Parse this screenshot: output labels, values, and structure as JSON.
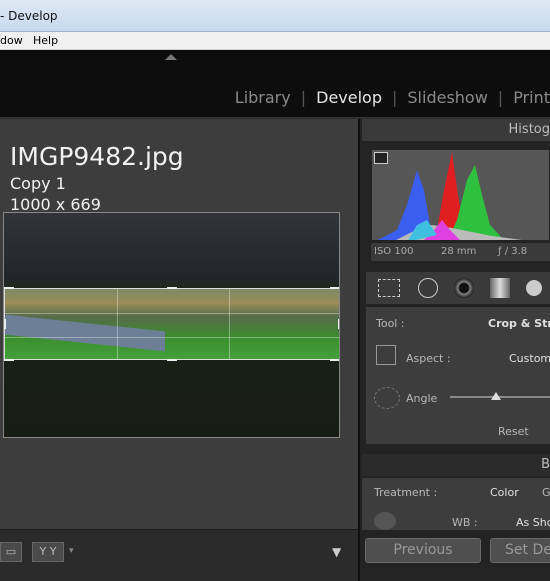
{
  "window": {
    "title": "- Develop"
  },
  "menu": {
    "window_label": "dow",
    "help_label": "Help"
  },
  "modules": {
    "library": "Library",
    "develop": "Develop",
    "slideshow": "Slideshow",
    "print": "Print"
  },
  "image": {
    "filename": "IMGP9482.jpg",
    "copy": "Copy 1",
    "dimensions": "1000 x 669"
  },
  "panel": {
    "histogram_label": "Histog",
    "iso": "ISO 100",
    "focal": "28 mm",
    "aperture": "ƒ / 3.8",
    "tool_label": "Tool :",
    "tool_value": "Crop & Stra",
    "aspect_label": "Aspect :",
    "aspect_value": "Custom",
    "angle_label": "Angle",
    "reset_label": "Reset",
    "basic_label": "B",
    "treatment_label": "Treatment :",
    "treatment_color": "Color",
    "treatment_gray": "G",
    "wb_label": "WB :",
    "wb_value": "As Sho"
  },
  "buttons": {
    "previous": "Previous",
    "set_default": "Set Def",
    "yy": "Y Y"
  },
  "colors": {
    "accent": "#e6e6e6",
    "panel_bg": "#3d3d3d"
  }
}
